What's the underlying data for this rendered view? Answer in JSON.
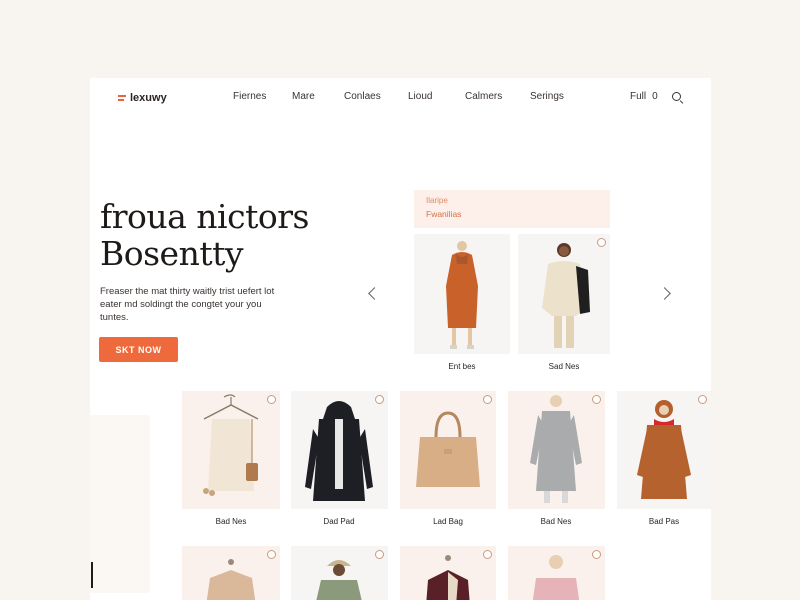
{
  "brand": {
    "name": "lexuwy",
    "accent": "#ee6a3c"
  },
  "nav": {
    "links": [
      "Fiernes",
      "Mare",
      "Conlaes",
      "Lioud",
      "Calmers",
      "Serings"
    ],
    "right_label": "Full",
    "right_count": "0",
    "search_icon": "search-icon"
  },
  "hero": {
    "title_line1": "froua nictors",
    "title_line2": "Bosentty",
    "description": "Freaser the mat thirty waitly trist uefert lot eater md soldingt the congtet your you tuntes.",
    "cta_label": "SKT NOW"
  },
  "promo": {
    "line1": "Ilaripe",
    "line2": "Fwanilias"
  },
  "featured": [
    {
      "caption": "Ent bes"
    },
    {
      "caption": "Sad Nes"
    }
  ],
  "products_row1": [
    {
      "caption": "Bad Nes"
    },
    {
      "caption": "Dad Pad"
    },
    {
      "caption": "Lad Bag"
    },
    {
      "caption": "Bad Nes"
    },
    {
      "caption": "Bad Pas"
    }
  ],
  "products_row2": [
    {
      "caption": ""
    },
    {
      "caption": ""
    },
    {
      "caption": ""
    },
    {
      "caption": ""
    }
  ],
  "carousel": {
    "prev_icon": "chevron-left-icon",
    "next_icon": "chevron-right-icon"
  }
}
